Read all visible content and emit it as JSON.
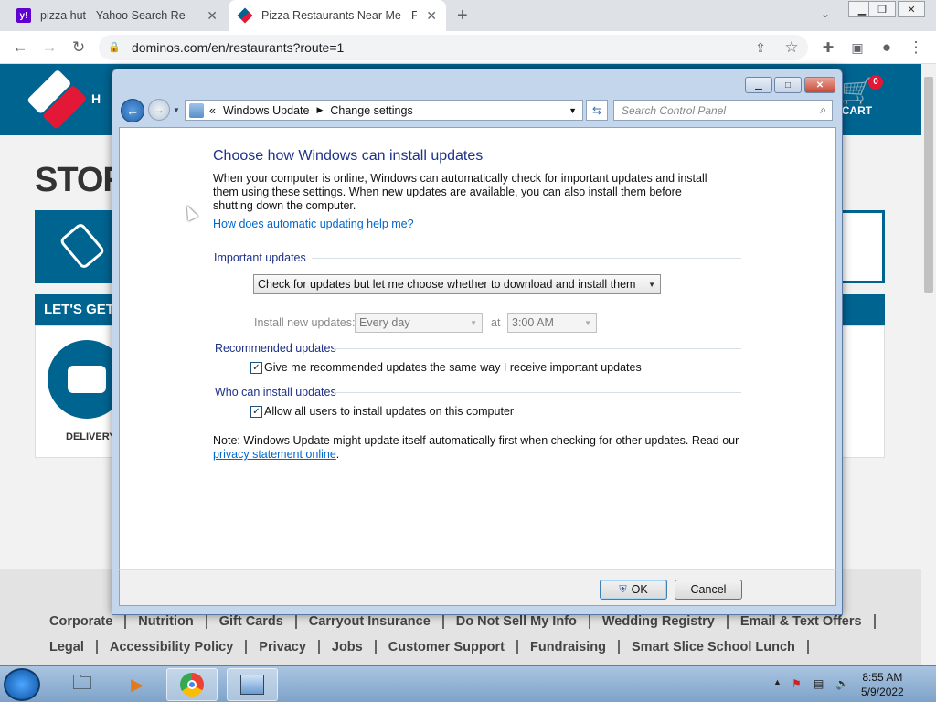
{
  "browser": {
    "tabs": [
      {
        "title": "pizza hut - Yahoo Search Results",
        "favicon": "y!"
      },
      {
        "title": "Pizza Restaurants Near Me - Find",
        "favicon": "dominos"
      }
    ],
    "url": "dominos.com/en/restaurants?route=1"
  },
  "site": {
    "heading_partial": "STOR",
    "lets_get_started_partial": "LET'S GET ST",
    "delivery_label": "DELIVERY",
    "cart_label": "CART",
    "cart_count": "0",
    "header_partial": "H",
    "footer_row1": [
      "Corporate",
      "Nutrition",
      "Gift Cards",
      "Carryout Insurance",
      "Do Not Sell My Info",
      "Wedding Registry",
      "Email & Text Offers"
    ],
    "footer_row2": [
      "Legal",
      "Accessibility Policy",
      "Privacy",
      "Jobs",
      "Customer Support",
      "Fundraising",
      "Smart Slice School Lunch"
    ]
  },
  "dialog": {
    "breadcrumb": [
      "Windows Update",
      "Change settings"
    ],
    "breadcrumb_prefix": "«",
    "search_placeholder": "Search Control Panel",
    "title": "Choose how Windows can install updates",
    "intro": "When your computer is online, Windows can automatically check for important updates and install them using these settings. When new updates are available, you can also install them before shutting down the computer.",
    "help_link": "How does automatic updating help me?",
    "important_section": "Important updates",
    "important_selected": "Check for updates but let me choose whether to download and install them",
    "install_label": "Install new updates:",
    "install_day": "Every day",
    "at_label": "at",
    "install_time": "3:00 AM",
    "recommended_section": "Recommended updates",
    "recommended_check": "Give me recommended updates the same way I receive important updates",
    "recommended_checked": true,
    "who_section": "Who can install updates",
    "who_check": "Allow all users to install updates on this computer",
    "who_checked": true,
    "note": "Note: Windows Update might update itself automatically first when checking for other updates.  Read our",
    "privacy_link": "privacy statement online",
    "period": ".",
    "ok": "OK",
    "cancel": "Cancel"
  },
  "taskbar": {
    "time": "8:55 AM",
    "date": "5/9/2022"
  }
}
